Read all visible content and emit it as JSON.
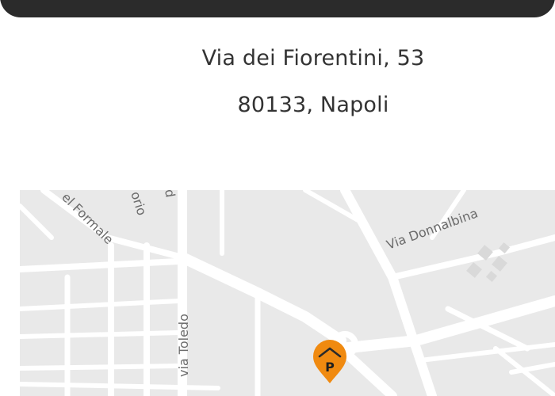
{
  "address": {
    "street": "Via dei Fiorentini, 53",
    "city": "80133, Napoli"
  },
  "map": {
    "labels": {
      "formale": "el Formale",
      "orio": "orio",
      "d": "d",
      "donnalbina": "Via Donnalbina",
      "toledo": "via Toledo"
    },
    "marker": {
      "letter": "P",
      "color": "#f08a10"
    }
  }
}
